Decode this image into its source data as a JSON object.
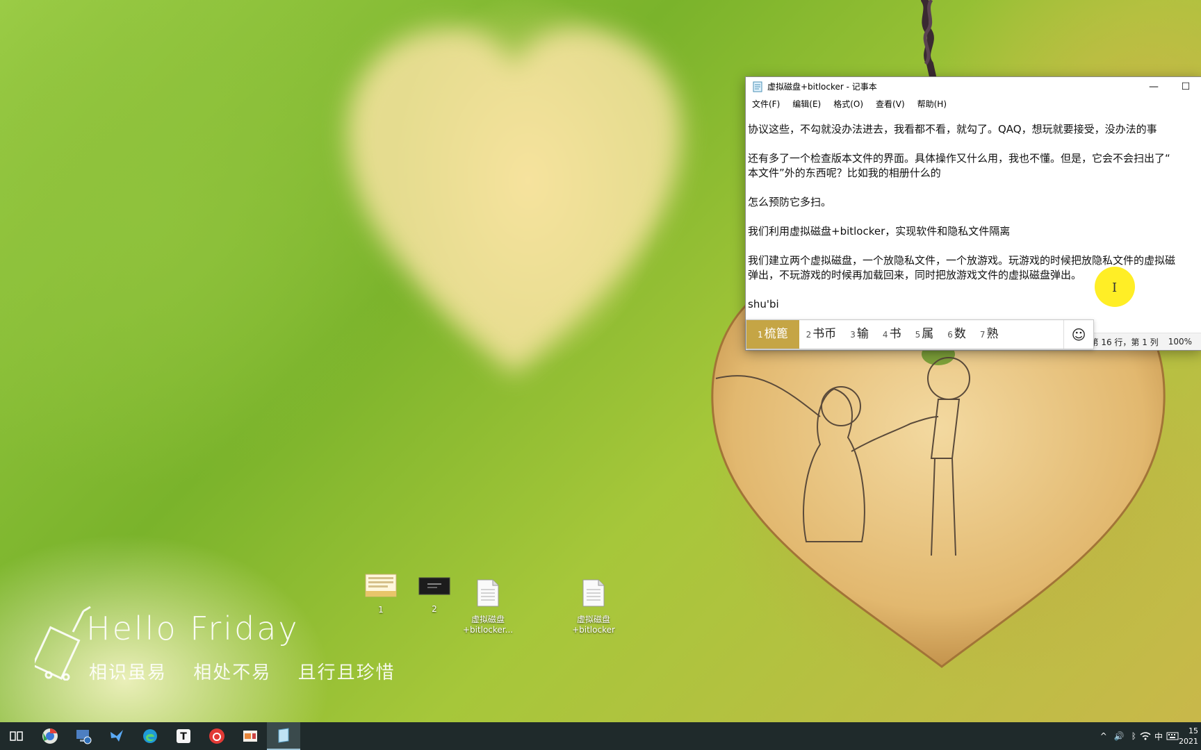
{
  "wallpaper": {
    "headline": "Hello  Friday",
    "motto": [
      "相识虽易",
      "相处不易",
      "且行且珍惜"
    ]
  },
  "desktop_icons": [
    {
      "label": "1",
      "type": "image-file"
    },
    {
      "label": "2",
      "type": "terminal-file"
    },
    {
      "label": "虚拟磁盘\n+bitlocker...",
      "type": "text-file"
    },
    {
      "label": "虚拟磁盘\n+bitlocker",
      "type": "text-file"
    }
  ],
  "notepad": {
    "title": "虚拟磁盘+bitlocker - 记事本",
    "menu": [
      "文件(F)",
      "编辑(E)",
      "格式(O)",
      "查看(V)",
      "帮助(H)"
    ],
    "lines": [
      "协议这些，不勾就没办法进去，我看都不看，就勾了。QAQ，想玩就要接受，没办法的事",
      "",
      "还有多了一个检查版本文件的界面。具体操作又什么用，我也不懂。但是，它会不会扫出了“",
      "本文件”外的东西呢？比如我的相册什么的",
      "",
      "怎么预防它多扫。",
      "",
      "我们利用虚拟磁盘+bitlocker，实现软件和隐私文件隔离",
      "",
      "我们建立两个虚拟磁盘，一个放隐私文件，一个放游戏。玩游戏的时候把放隐私文件的虚拟磁",
      "弹出，不玩游戏的时候再加载回来，同时把放游戏文件的虚拟磁盘弹出。",
      "",
      "shu'bi"
    ],
    "status": {
      "position": "第 16 行，第 1 列",
      "zoom": "100%"
    },
    "window_buttons": {
      "minimize": "—",
      "maximize": "☐"
    }
  },
  "ime": {
    "candidates": [
      {
        "n": "1",
        "text": "梳篦",
        "selected": true
      },
      {
        "n": "2",
        "text": "书币"
      },
      {
        "n": "3",
        "text": "输"
      },
      {
        "n": "4",
        "text": "书"
      },
      {
        "n": "5",
        "text": "属"
      },
      {
        "n": "6",
        "text": "数"
      },
      {
        "n": "7",
        "text": "熟"
      }
    ],
    "emoji": "☺"
  },
  "taskbar": {
    "apps": [
      "task-view",
      "chrome",
      "computer-manager",
      "feishu",
      "edge",
      "typora",
      "netease-music",
      "presentation",
      "notepad"
    ],
    "tray": {
      "chevron": "^",
      "volume": "🔊",
      "bluetooth": "ᛒ",
      "wifi": "wifi",
      "ime": "中",
      "time": "15",
      "date": "2021"
    }
  }
}
